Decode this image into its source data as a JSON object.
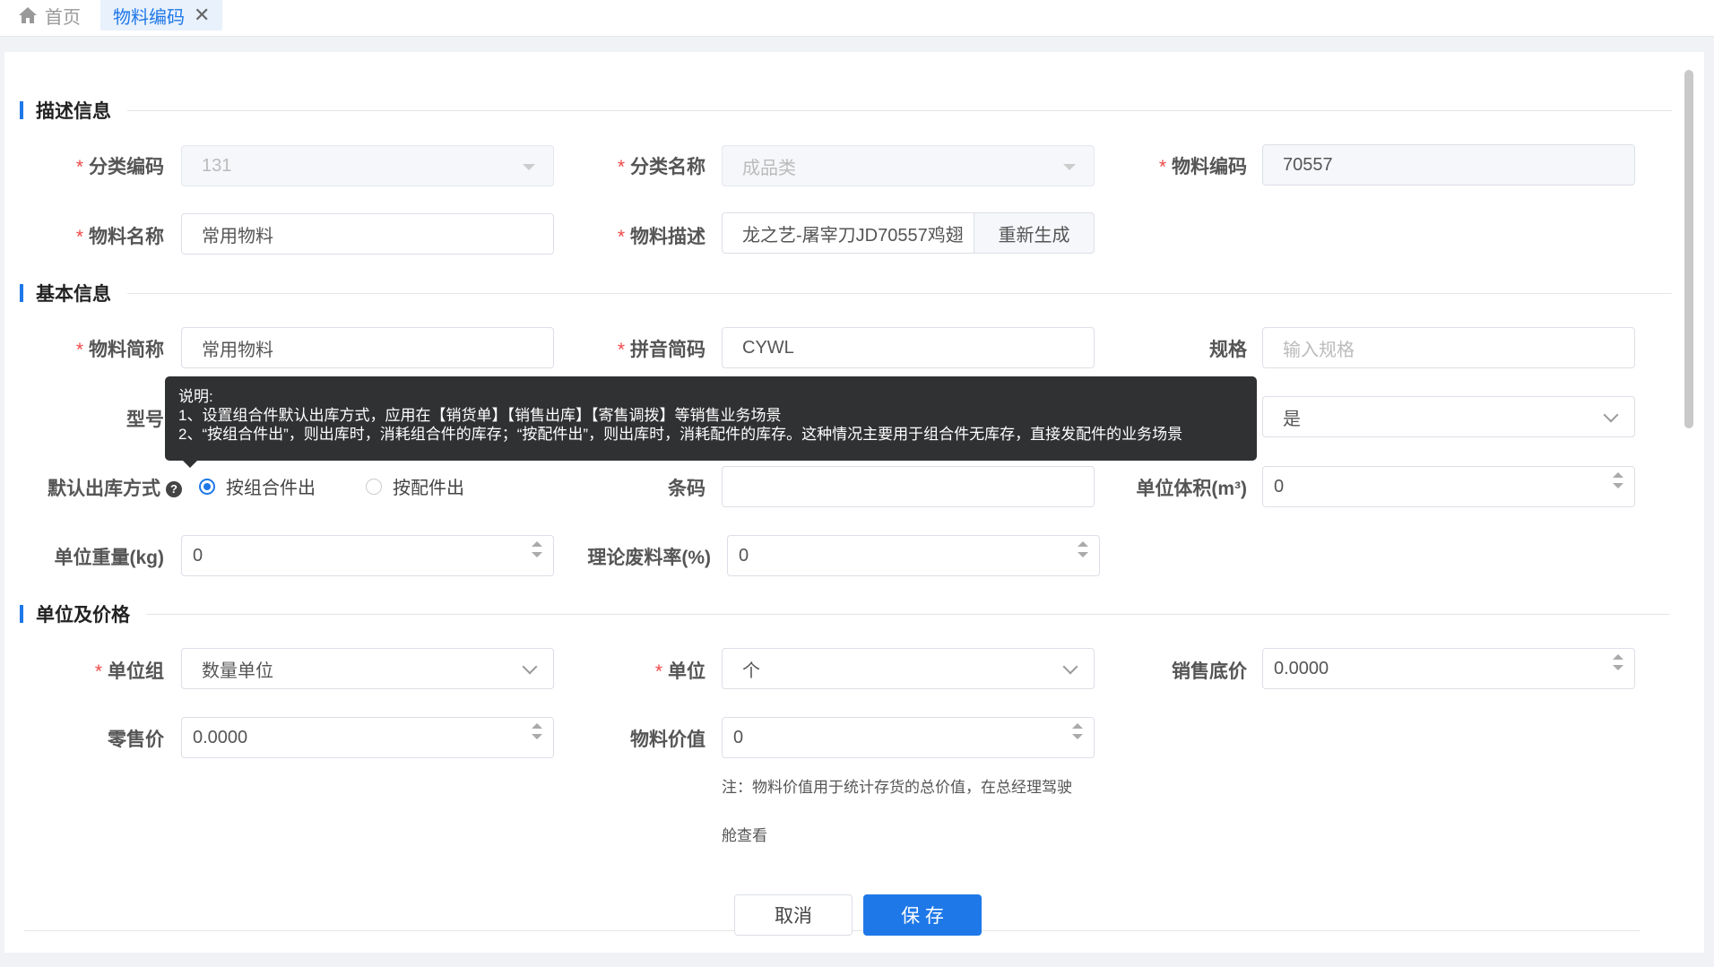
{
  "tabs": {
    "home": "首页",
    "active": "物料编码"
  },
  "sections": {
    "desc": "描述信息",
    "basic": "基本信息",
    "price": "单位及价格"
  },
  "fields": {
    "category_code": {
      "label": "分类编码",
      "value": "131"
    },
    "category_name": {
      "label": "分类名称",
      "value": "成品类"
    },
    "material_code": {
      "label": "物料编码",
      "value": "70557"
    },
    "material_name": {
      "label": "物料名称",
      "value": "常用物料"
    },
    "material_desc": {
      "label": "物料描述",
      "value": "龙之艺-屠宰刀JD70557鸡翅",
      "button": "重新生成"
    },
    "short_name": {
      "label": "物料简称",
      "value": "常用物料"
    },
    "pinyin": {
      "label": "拼音简码",
      "value": "CYWL"
    },
    "spec": {
      "label": "规格",
      "placeholder": "输入规格"
    },
    "model": {
      "label": "型号"
    },
    "third_select": {
      "value": "是"
    },
    "outbound": {
      "label": "默认出库方式",
      "opt1": "按组合件出",
      "opt2": "按配件出"
    },
    "barcode": {
      "label": "条码",
      "value": ""
    },
    "unit_volume": {
      "label": "单位体积(m³)",
      "value": "0"
    },
    "unit_weight": {
      "label": "单位重量(kg)",
      "value": "0"
    },
    "scrap_rate": {
      "label": "理论废料率(%)",
      "value": "0"
    },
    "unit_group": {
      "label": "单位组",
      "value": "数量单位"
    },
    "unit": {
      "label": "单位",
      "value": "个"
    },
    "min_price": {
      "label": "销售底价",
      "value": "0.0000"
    },
    "retail": {
      "label": "零售价",
      "value": "0.0000"
    },
    "material_value": {
      "label": "物料价值",
      "value": "0"
    }
  },
  "note": {
    "line1": "注：物料价值用于统计存货的总价值，在总经理驾驶",
    "line2": "舱查看"
  },
  "tooltip": {
    "title": "说明:",
    "line1": "1、设置组合件默认出库方式，应用在【销货单】【销售出库】【寄售调拨】等销售业务场景",
    "line2": "2、“按组合件出”，则出库时，消耗组合件的库存；“按配件出”，则出库时，消耗配件的库存。这种情况主要用于组合件无库存，直接发配件的业务场景"
  },
  "buttons": {
    "cancel": "取消",
    "save": "保 存"
  },
  "colors": {
    "primary": "#1f78e8",
    "required": "#f04848",
    "tooltip_bg": "#303133"
  }
}
